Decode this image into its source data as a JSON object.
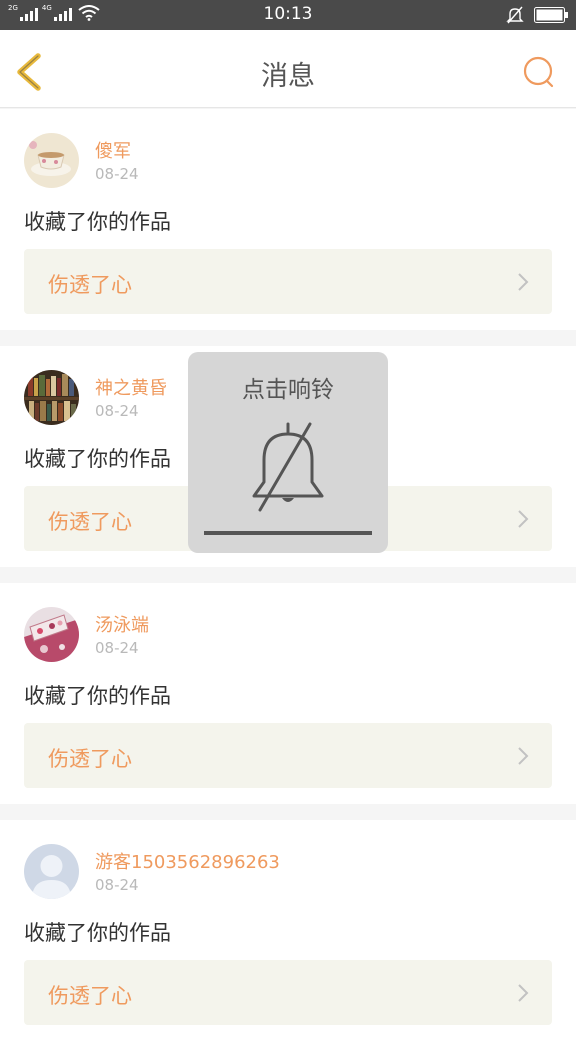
{
  "status_bar": {
    "time": "10:13",
    "net1": "2G",
    "net2": "4G",
    "icons": [
      "signal-icon",
      "signal-icon",
      "wifi-icon",
      "ringer-off-icon",
      "battery-icon"
    ]
  },
  "header": {
    "title": "消息",
    "back_icon": "chevron-left-icon",
    "search_icon": "search-icon"
  },
  "messages": [
    {
      "user": "傻军",
      "date": "08-24",
      "action": "收藏了你的作品",
      "work": "伤透了心"
    },
    {
      "user": "神之黄昏",
      "date": "08-24",
      "action": "收藏了你的作品",
      "work": "伤透了心"
    },
    {
      "user": "汤泳端",
      "date": "08-24",
      "action": "收藏了你的作品",
      "work": "伤透了心"
    },
    {
      "user": "游客1503562896263",
      "date": "08-24",
      "action": "收藏了你的作品",
      "work": "伤透了心"
    }
  ],
  "toast": {
    "text": "点击响铃",
    "icon": "bell-off-icon"
  },
  "colors": {
    "accent": "#ef9a5e",
    "back_arrow": "#e8b93c",
    "status_bar": "#4a4a4a",
    "work_box": "#f4f4ec"
  }
}
